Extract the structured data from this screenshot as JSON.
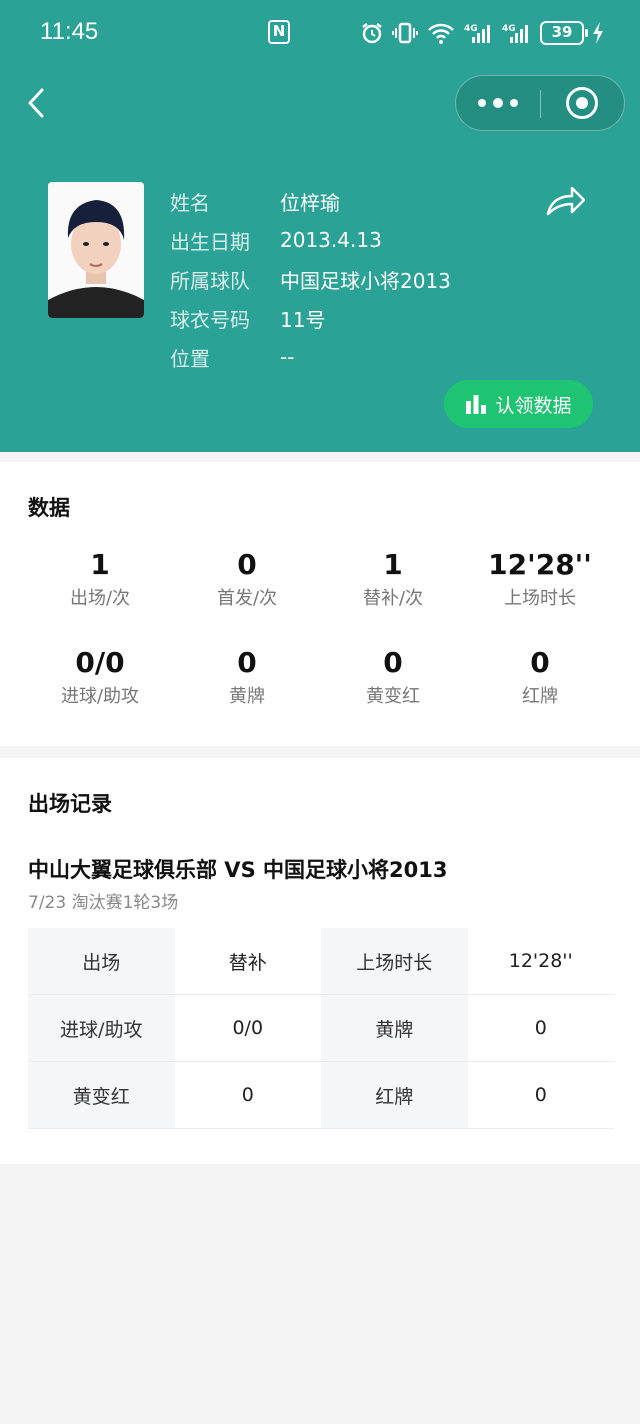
{
  "status_bar": {
    "time": "11:45",
    "nfc": "N",
    "battery": "39",
    "network": "4G"
  },
  "icons": {
    "back": "back-chevron-icon",
    "more": "more-dots-icon",
    "close": "capsule-close-icon",
    "share": "share-arrow-icon",
    "chart": "bar-chart-icon"
  },
  "profile": {
    "rows": [
      {
        "label": "姓名",
        "value": "位梓瑜"
      },
      {
        "label": "出生日期",
        "value": "2013.4.13"
      },
      {
        "label": "所属球队",
        "value": "中国足球小将2013"
      },
      {
        "label": "球衣号码",
        "value": "11号"
      },
      {
        "label": "位置",
        "value": "--"
      }
    ],
    "claim_label": "认领数据"
  },
  "stats": {
    "title": "数据",
    "items": [
      {
        "value": "1",
        "label": "出场/次"
      },
      {
        "value": "0",
        "label": "首发/次"
      },
      {
        "value": "1",
        "label": "替补/次"
      },
      {
        "value": "12'28''",
        "label": "上场时长"
      },
      {
        "value": "0/0",
        "label": "进球/助攻"
      },
      {
        "value": "0",
        "label": "黄牌"
      },
      {
        "value": "0",
        "label": "黄变红"
      },
      {
        "value": "0",
        "label": "红牌"
      }
    ]
  },
  "records": {
    "title": "出场记录",
    "match": {
      "title": "中山大翼足球俱乐部 VS 中国足球小将2013",
      "subtitle": "7/23 淘汰赛1轮3场",
      "grid": [
        [
          "出场",
          "替补",
          "上场时长",
          "12'28''"
        ],
        [
          "进球/助攻",
          "0/0",
          "黄牌",
          "0"
        ],
        [
          "黄变红",
          "0",
          "红牌",
          "0"
        ]
      ]
    }
  },
  "colors": {
    "header_bg": "#2aa296",
    "claim_button": "#1fc472"
  }
}
